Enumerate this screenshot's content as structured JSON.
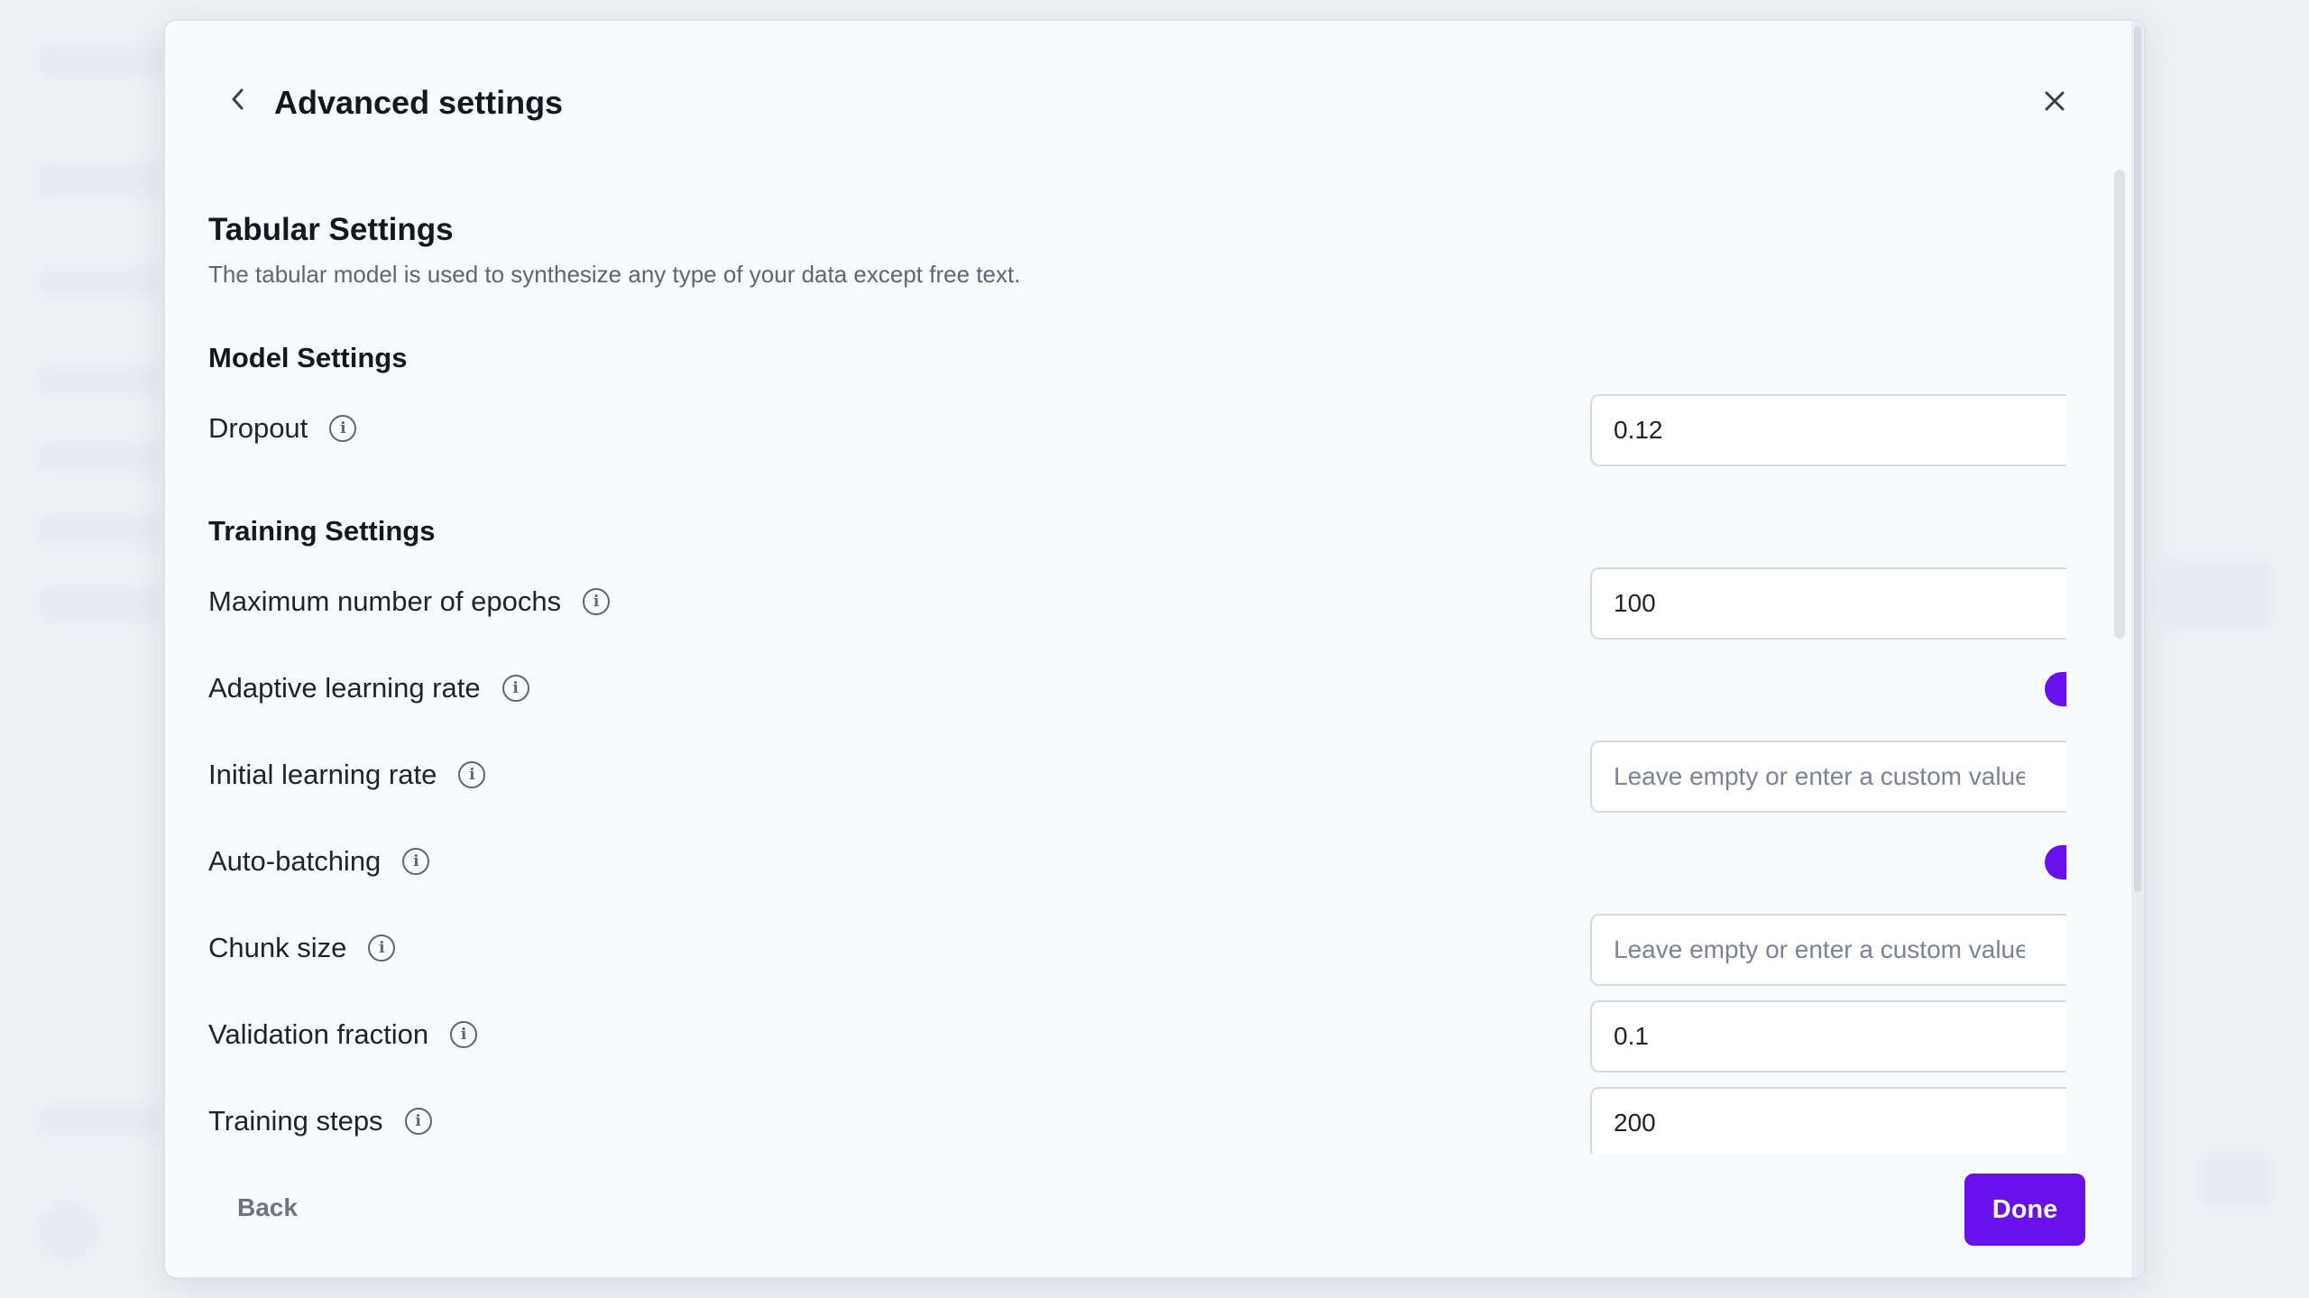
{
  "modal": {
    "title": "Advanced settings"
  },
  "tabular": {
    "title": "Tabular Settings",
    "description": "The tabular model is used to synthesize any type of your data except free text."
  },
  "model_settings": {
    "title": "Model Settings",
    "dropout": {
      "label": "Dropout",
      "value": "0.12"
    }
  },
  "training_settings": {
    "title": "Training Settings",
    "max_epochs": {
      "label": "Maximum number of epochs",
      "value": "100"
    },
    "adaptive_lr": {
      "label": "Adaptive learning rate",
      "enabled": true
    },
    "initial_lr": {
      "label": "Initial learning rate",
      "placeholder": "Leave empty or enter a custom value"
    },
    "auto_batching": {
      "label": "Auto-batching",
      "enabled": true
    },
    "chunk_size": {
      "label": "Chunk size",
      "placeholder": "Leave empty or enter a custom value"
    },
    "validation_fraction": {
      "label": "Validation fraction",
      "value": "0.1"
    },
    "training_steps": {
      "label": "Training steps",
      "value": "200"
    }
  },
  "footer": {
    "back_label": "Back",
    "done_label": "Done"
  },
  "colors": {
    "accent": "#6a10ea",
    "text": "#1f232b",
    "muted": "#5d6675"
  }
}
